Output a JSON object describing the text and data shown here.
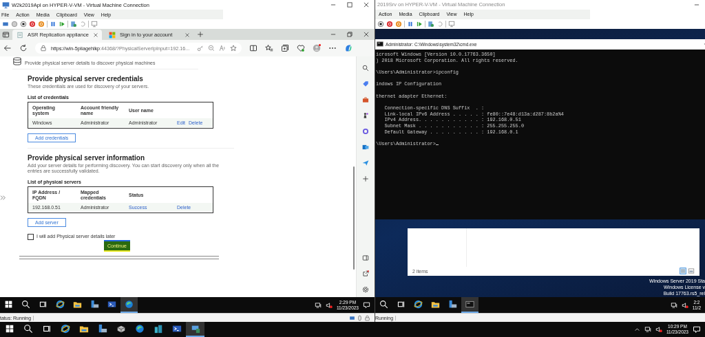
{
  "left_vm": {
    "title": "W2k2019Apl on HYPER-V-VM - Virtual Machine Connection",
    "menu": [
      "File",
      "Action",
      "Media",
      "Clipboard",
      "View",
      "Help"
    ],
    "browser": {
      "tabs": [
        {
          "label": "ASR Replication appliance",
          "selected": true
        },
        {
          "label": "Sign in to your account",
          "selected": false
        }
      ],
      "address": {
        "host": "https://win-5piiagehlkp",
        "rest": ":44368/?PhysicalServerIpInput=192.16..."
      },
      "page": {
        "header_subtitle": "Provide physical server details to discover physical machines",
        "sections": [
          {
            "title": "Provide physical server credentials",
            "description": "These credentials are used for discovery of your servers.",
            "list_label": "List of credentials",
            "columns": [
              "Operating system",
              "Account friendly name",
              "User name"
            ],
            "rows": [
              {
                "cells": [
                  "Windows",
                  "Administrator",
                  "Administrator"
                ],
                "links": [
                  "Edit",
                  "Delete"
                ]
              }
            ],
            "button": "Add credentials"
          },
          {
            "title": "Provide physical server information",
            "description": "Add your server details for performing discovery. You can start discovery only when all the entries are successfully validated.",
            "list_label": "List of physical servers",
            "columns": [
              "IP Address / FQDN",
              "Mapped credentials",
              "Status"
            ],
            "rows": [
              {
                "cells": [
                  "192.168.0.51",
                  "Administrator"
                ],
                "links": [
                  "Success",
                  "Delete"
                ]
              }
            ],
            "button": "Add server"
          }
        ],
        "checkbox": {
          "label": "I will add Physical server details later",
          "checked": false
        },
        "continue": "Continue"
      }
    },
    "taskbar": {
      "buttons": [
        {
          "selected": false
        },
        {
          "selected": false
        },
        {
          "selected": false
        },
        {
          "selected": false
        },
        {
          "selected": false
        },
        {
          "selected": false
        },
        {
          "selected": false
        },
        {
          "selected": true
        }
      ],
      "time": "2:29 PM",
      "date": "11/23/2023"
    },
    "status": "tatus: Running"
  },
  "right_vm": {
    "title": "2019Srv on HYPER-V-VM - Virtual Machine Connection",
    "menu": [
      "Action",
      "Media",
      "Clipboard",
      "View",
      "Help"
    ],
    "cmd": {
      "title": "Administrator: C:\\Windows\\system32\\cmd.exe",
      "blocks": [
        [
          "icrosoft Windows [Version 10.0.17763.3650]",
          ") 2018 Microsoft Corporation. All rights reserved."
        ],
        [
          "\\Users\\Administrator>ipconfig"
        ],
        [
          "indows IP Configuration"
        ],
        [
          "thernet adapter Ethernet:"
        ],
        [
          "   Connection-specific DNS Suffix  . :",
          "   Link-local IPv6 Address . . . . . : fe80::7e48:d13a:d287:8b2a%4",
          "   IPv4 Address. . . . . . . . . . . : 192.168.0.51",
          "   Subnet Mask . . . . . . . . . . . : 255.255.255.0",
          "   Default Gateway . . . . . . . . . : 192.168.0.1"
        ],
        [
          "\\Users\\Administrator>"
        ]
      ]
    },
    "explorer": {
      "status": "2 items"
    },
    "desktop_text": [
      "Windows Server 2019 Sta",
      "Windows License v",
      "Build 17763.rs5_rel"
    ],
    "taskbar": {
      "buttons": [
        {
          "selected": false
        },
        {
          "selected": false
        },
        {
          "selected": false
        },
        {
          "selected": false
        },
        {
          "selected": false
        },
        {
          "selected": true
        }
      ],
      "time": "2:2",
      "date": "11/2"
    },
    "status": "Running"
  },
  "host_taskbar": {
    "buttons": [
      {
        "selected": false
      },
      {
        "selected": false
      },
      {
        "selected": false
      },
      {
        "selected": false
      },
      {
        "selected": false
      },
      {
        "selected": false
      },
      {
        "selected": false
      },
      {
        "selected": false
      },
      {
        "selected": false
      },
      {
        "selected": false
      },
      {
        "selected": true
      }
    ],
    "time": "10:29 PM",
    "date": "11/23/2023"
  }
}
